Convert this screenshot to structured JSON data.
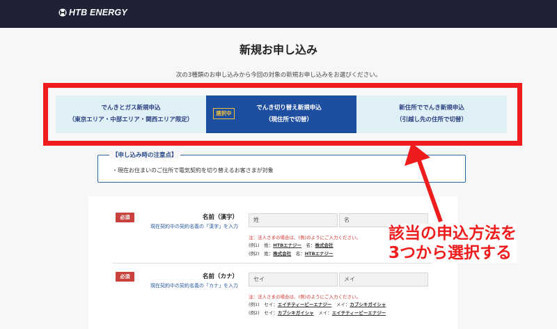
{
  "header": {
    "logo_text": "HTB ENERGY"
  },
  "page": {
    "title": "新規お申し込み",
    "subtitle": "次の3種類のお申し込みから今回の対象の新規お申し込みをお選びください。"
  },
  "tabs": [
    {
      "line1": "でんきとガス新規申込",
      "line2": "（東京エリア・中部エリア・関西エリア限定）",
      "active": false
    },
    {
      "line1": "でんき切り替え新規申込",
      "line2": "（現住所で切替）",
      "active": true,
      "badge": "選択中"
    },
    {
      "line1": "新住所ででんき新規申込",
      "line2": "（引越し先の住所で切替）",
      "active": false
    }
  ],
  "notice": {
    "title": "【申し込み時の注意点】",
    "text": "・現在お住まいのご住所で電気契約を切り替えるお客さまが対象"
  },
  "form": {
    "kanji": {
      "required": "必須",
      "label": "名前（漢字）",
      "sub": "現在契約中の契約名義の「漢字」を入力",
      "placeholder_last": "姓",
      "placeholder_first": "名",
      "note": "注：法人さまの場合は、(例)のようにご入力ください。",
      "ex1_prefix": "(例1)　姓：",
      "ex1_a": "HTBエナジー",
      "ex1_mid": "　名：",
      "ex1_b": "株式会社",
      "ex2_prefix": "(例2)　姓：",
      "ex2_a": "株式会社",
      "ex2_mid": "　名：",
      "ex2_b": "HTBエナジー"
    },
    "kana": {
      "required": "必須",
      "label": "名前（カナ）",
      "sub": "現在契約中の契約名義の「カナ」を入力",
      "placeholder_last": "セイ",
      "placeholder_first": "メイ",
      "note": "注：法人さまの場合は、(例)のようにご入力ください。",
      "ex1_prefix": "(例1)　セイ：",
      "ex1_a": "エイチティービーエナジー",
      "ex1_mid": "　メイ：",
      "ex1_b": "カブシキガイシャ",
      "ex2_prefix": "(例2)　セイ：",
      "ex2_a": "カブシキガイシャ",
      "ex2_mid": "　メイ：",
      "ex2_b": "エイチティービーエナジー"
    }
  },
  "annotation": {
    "line1": "該当の申込方法を",
    "line2": "3つから選択する",
    "color": "#ee1c1c"
  }
}
